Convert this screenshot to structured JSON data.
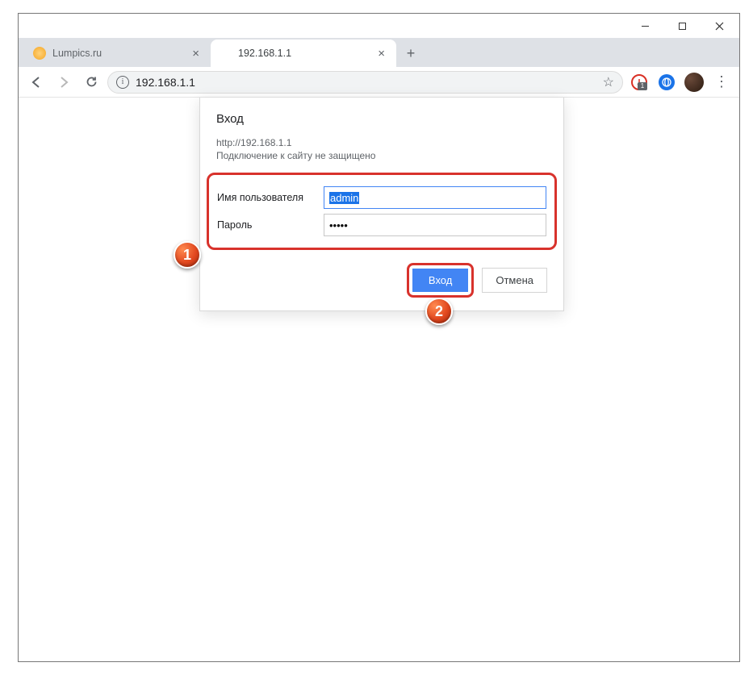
{
  "window": {
    "tabs": [
      {
        "title": "Lumpics.ru",
        "active": false
      },
      {
        "title": "192.168.1.1",
        "active": true
      }
    ]
  },
  "toolbar": {
    "url": "192.168.1.1",
    "adblock_count": "1"
  },
  "dialog": {
    "title": "Вход",
    "origin": "http://192.168.1.1",
    "warning": "Подключение к сайту не защищено",
    "username_label": "Имя пользователя",
    "username_value": "admin",
    "password_label": "Пароль",
    "password_value": "•••••",
    "login_button": "Вход",
    "cancel_button": "Отмена"
  },
  "annotations": {
    "badge1": "1",
    "badge2": "2"
  }
}
